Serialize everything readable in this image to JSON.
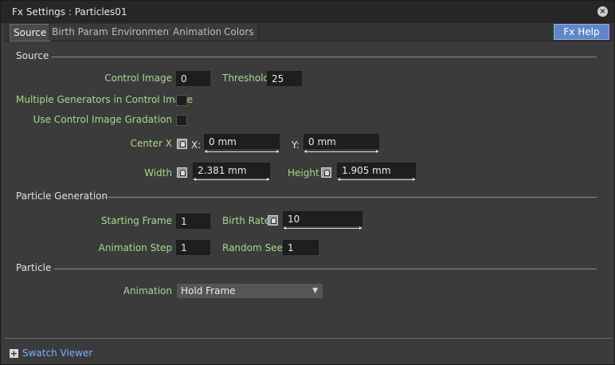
{
  "window": {
    "title": "Fx Settings : Particles01"
  },
  "tabs": [
    {
      "label": "Source"
    },
    {
      "label": "Birth Params"
    },
    {
      "label": "Environment"
    },
    {
      "label": "Animation"
    },
    {
      "label": "Colors"
    }
  ],
  "fx_help": "Fx Help",
  "sections": {
    "source": "Source",
    "particle_generation": "Particle Generation",
    "particle": "Particle"
  },
  "fields": {
    "control_image": {
      "label": "Control Image",
      "value": "0"
    },
    "threshold": {
      "label": "Threshold",
      "value": "25"
    },
    "multiple_generators": {
      "label": "Multiple Generators in Control Image"
    },
    "use_gradation": {
      "label": "Use Control Image Gradation"
    },
    "center": {
      "label": "Center X",
      "x_label": "X:",
      "x_value": "0 mm",
      "y_label": "Y:",
      "y_value": "0 mm"
    },
    "width": {
      "label": "Width",
      "value": "2.381 mm"
    },
    "height": {
      "label": "Height",
      "value": "1.905 mm"
    },
    "starting_frame": {
      "label": "Starting Frame",
      "value": "1"
    },
    "birth_rate": {
      "label": "Birth Rate",
      "value": "10"
    },
    "animation_step": {
      "label": "Animation Step",
      "value": "1"
    },
    "random_seed": {
      "label": "Random Seed",
      "value": "1"
    },
    "animation": {
      "label": "Animation",
      "selected": "Hold Frame"
    }
  },
  "footer": {
    "swatch_viewer": "Swatch Viewer"
  },
  "colors": {
    "label_green": "#a8d88c",
    "accent_blue": "#5f87c8",
    "link_blue": "#79b0ff"
  }
}
